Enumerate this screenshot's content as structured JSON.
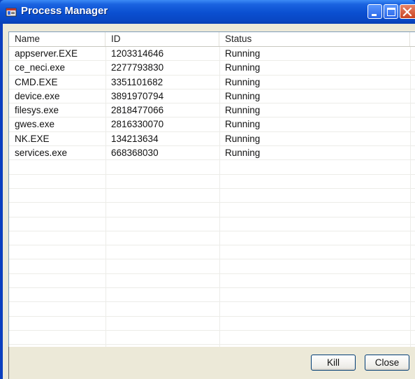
{
  "window": {
    "title": "Process Manager"
  },
  "table": {
    "columns": [
      "Name",
      "ID",
      "Status"
    ],
    "rows": [
      {
        "name": "appserver.EXE",
        "id": "1203314646",
        "status": "Running"
      },
      {
        "name": "ce_neci.exe",
        "id": "2277793830",
        "status": "Running"
      },
      {
        "name": "CMD.EXE",
        "id": "3351101682",
        "status": "Running"
      },
      {
        "name": "device.exe",
        "id": "3891970794",
        "status": "Running"
      },
      {
        "name": "filesys.exe",
        "id": "2818477066",
        "status": "Running"
      },
      {
        "name": "gwes.exe",
        "id": "2816330070",
        "status": "Running"
      },
      {
        "name": "NK.EXE",
        "id": "134213634",
        "status": "Running"
      },
      {
        "name": "services.exe",
        "id": "668368030",
        "status": "Running"
      }
    ]
  },
  "buttons": {
    "kill": "Kill",
    "close": "Close"
  },
  "icons": {
    "app": "app-window-icon",
    "minimize": "minimize-icon",
    "maximize": "maximize-icon",
    "close": "close-icon"
  },
  "colors": {
    "titlebar": "#0a4fd0",
    "close_button": "#c94423",
    "client_bg": "#ece9d8"
  }
}
